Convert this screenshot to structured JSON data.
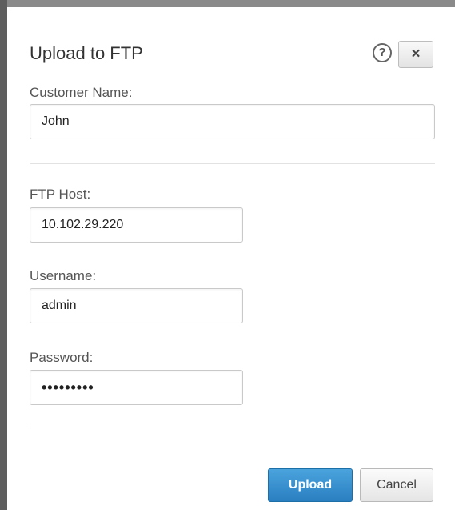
{
  "dialog": {
    "title": "Upload to FTP",
    "help_glyph": "?",
    "close_glyph": "×"
  },
  "fields": {
    "customer_name": {
      "label": "Customer Name:",
      "value": "John"
    },
    "ftp_host": {
      "label": "FTP Host:",
      "value": "10.102.29.220"
    },
    "username": {
      "label": "Username:",
      "value": "admin"
    },
    "password": {
      "label": "Password:",
      "value": "•••••••••"
    }
  },
  "buttons": {
    "upload_label": "Upload",
    "cancel_label": "Cancel"
  },
  "icons": {
    "help": "help-circle-icon",
    "close": "close-icon"
  },
  "colors": {
    "primary_button": "#2a7fc0",
    "frame_edge": "#5e5e5e"
  }
}
